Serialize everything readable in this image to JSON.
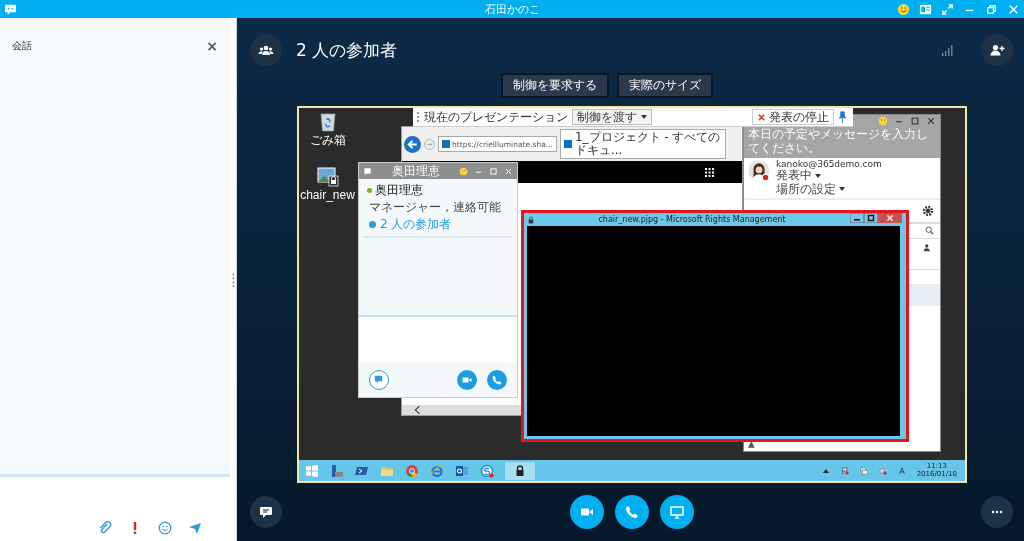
{
  "window": {
    "title": "石田かのこ"
  },
  "conversation_panel": {
    "title": "会話",
    "close": "×"
  },
  "meeting": {
    "title": "2 人の参加者"
  },
  "share_buttons": [
    {
      "label": "制御を要求する"
    },
    {
      "label": "実際のサイズ"
    }
  ],
  "shared_screen": {
    "desktop_icons": [
      {
        "label": "ごみ箱",
        "kind": "recycle"
      },
      {
        "label": "chair_new",
        "kind": "image"
      }
    ],
    "presentation_bar": {
      "label": "現在のプレゼンテーション",
      "dropdown": "制御を渡す",
      "stop": "発表の停止"
    },
    "browser": {
      "url": "https://crieilluminate.sha...",
      "tab": "1_プロジェクト - すべてのドキュ..."
    },
    "contact_window": {
      "title": "奥田理恵",
      "name": "奥田理恵",
      "status": "マネージャー，連絡可能",
      "participants": "2 人の参加者"
    },
    "skype_window": {
      "prompt": "本日の予定やメッセージを入力してください。",
      "account": "kanoko@365demo.com",
      "presence": "発表中",
      "location": "場所の設定"
    },
    "rms_window": {
      "title": "chair_new.pjpg - Microsoft Rights Management"
    },
    "taskbar": {
      "time": "11:13",
      "date": "2016/01/10"
    }
  }
}
